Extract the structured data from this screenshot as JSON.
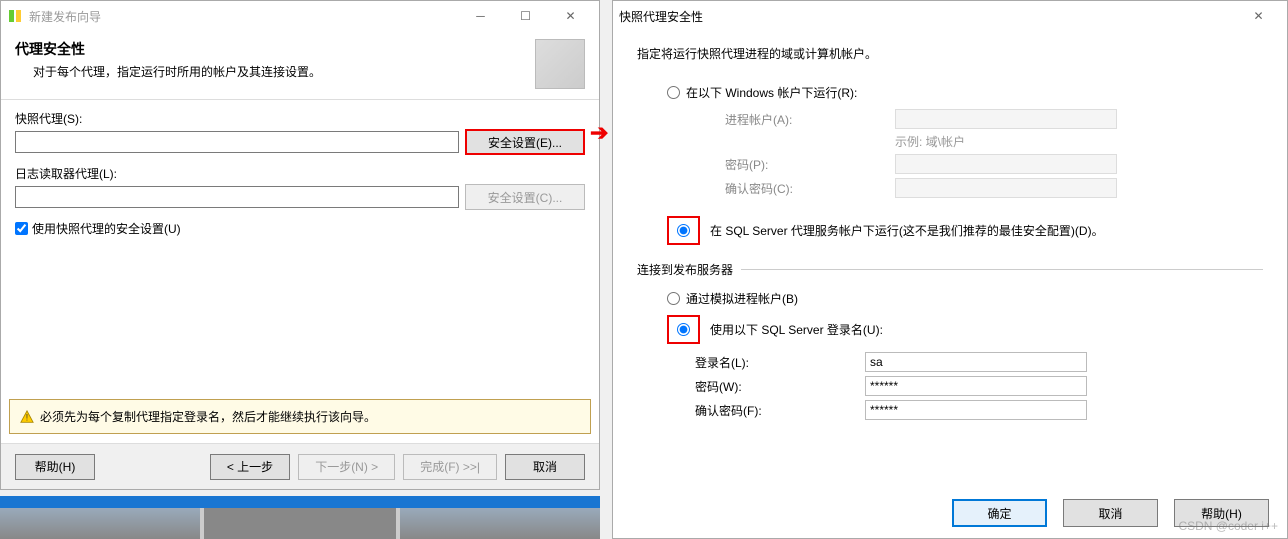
{
  "left_window": {
    "title": "新建发布向导",
    "header_title": "代理安全性",
    "header_sub": "对于每个代理，指定运行时所用的帐户及其连接设置。",
    "snapshot_label": "快照代理(S):",
    "snapshot_value": "",
    "security_btn_e": "安全设置(E)...",
    "logreader_label": "日志读取器代理(L):",
    "logreader_value": "",
    "security_btn_c": "安全设置(C)...",
    "checkbox_label": "使用快照代理的安全设置(U)",
    "warning_text": "必须先为每个复制代理指定登录名，然后才能继续执行该向导。",
    "footer": {
      "help": "帮助(H)",
      "back": "< 上一步",
      "next": "下一步(N) >",
      "finish": "完成(F) >>|",
      "cancel": "取消"
    }
  },
  "right_window": {
    "title": "快照代理安全性",
    "desc": "指定将运行快照代理进程的域或计算机帐户。",
    "radio_windows": "在以下 Windows 帐户下运行(R):",
    "row_process": "进程帐户(A):",
    "hint_example": "示例: 域\\帐户",
    "row_password": "密码(P):",
    "row_confirm": "确认密码(C):",
    "radio_sql_agent": "在 SQL Server 代理服务帐户下运行(这不是我们推荐的最佳安全配置)(D)。",
    "fieldset_legend": "连接到发布服务器",
    "radio_impersonate": "通过模拟进程帐户(B)",
    "radio_sql_login": "使用以下 SQL Server 登录名(U):",
    "row_login": "登录名(L):",
    "login_value": "sa",
    "row_pw": "密码(W):",
    "pw_value": "******",
    "row_confirm2": "确认密码(F):",
    "confirm2_value": "******",
    "footer": {
      "ok": "确定",
      "cancel": "取消",
      "help": "帮助(H)"
    }
  },
  "watermark": "CSDN @coder i++"
}
